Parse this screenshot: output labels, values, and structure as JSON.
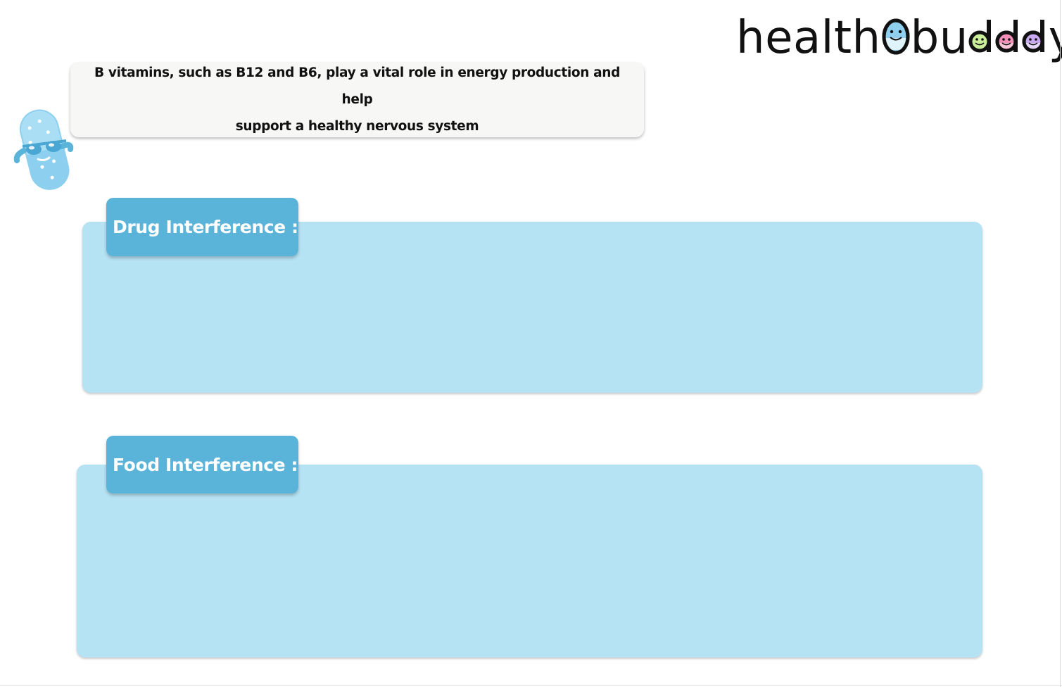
{
  "logo": {
    "part_before": "health",
    "part_middle": "b",
    "part_u": "u",
    "part_d": "d",
    "part_end": "y",
    "face_colors": {
      "o_face": "#8fd0f0",
      "d1_face": "#c9ef9a",
      "d2_face": "#f38fb6",
      "d3_face": "#c8a8ef"
    }
  },
  "mascot": {
    "icon": "pill-mascot-icon",
    "color": "#7fcbea"
  },
  "bubble": {
    "line1": "B vitamins, such as B12 and B6, play a vital role in energy production and help",
    "line2": "support a healthy nervous system"
  },
  "sections": {
    "drug": {
      "label": "Drug Interference :"
    },
    "food": {
      "label": "Food Interference :"
    }
  },
  "colors": {
    "panel_bg": "#b6e3f4",
    "tab_bg": "#5ab3d9",
    "bubble_bg": "#f7f7f6"
  }
}
